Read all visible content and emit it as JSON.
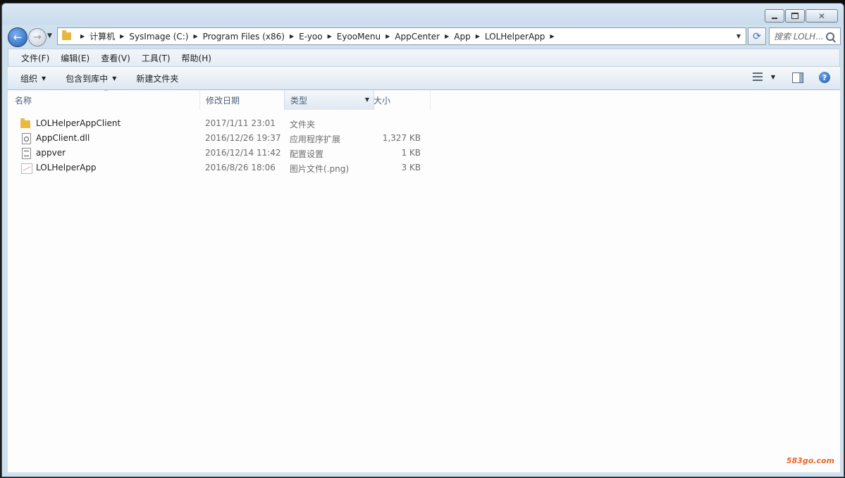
{
  "window": {
    "caption_buttons": {
      "minimize": "minimize-icon",
      "maximize": "maximize-icon",
      "close": "✕"
    }
  },
  "navbar": {
    "back_glyph": "←",
    "forward_glyph": "→",
    "recent_glyph": "▼",
    "breadcrumbs": [
      "计算机",
      "SysImage (C:)",
      "Program Files (x86)",
      "E-yoo",
      "EyooMenu",
      "AppCenter",
      "App",
      "LOLHelperApp"
    ],
    "address_dropdown": "▼",
    "refresh_glyph": "⟳",
    "search_placeholder": "搜索 LOLH..."
  },
  "menubar": {
    "items": [
      "文件(F)",
      "编辑(E)",
      "查看(V)",
      "工具(T)",
      "帮助(H)"
    ]
  },
  "commandbar": {
    "organize": "组织",
    "include_library": "包含到库中",
    "new_folder": "新建文件夹",
    "dropdown_glyph": "▼",
    "help": "?"
  },
  "columns": {
    "name": "名称",
    "date": "修改日期",
    "type": "类型",
    "size": "大小",
    "sort_glyph": "^"
  },
  "files": [
    {
      "name": "LOLHelperAppClient",
      "date": "2017/1/11 23:01",
      "type": "文件夹",
      "size": "",
      "icon": "folder-icon"
    },
    {
      "name": "AppClient.dll",
      "date": "2016/12/26 19:37",
      "type": "应用程序扩展",
      "size": "1,327 KB",
      "icon": "dll-file-icon"
    },
    {
      "name": "appver",
      "date": "2016/12/14 11:42",
      "type": "配置设置",
      "size": "1 KB",
      "icon": "config-file-icon"
    },
    {
      "name": "LOLHelperApp",
      "date": "2016/8/26 18:06",
      "type": "图片文件(.png)",
      "size": "3 KB",
      "icon": "image-file-icon"
    }
  ],
  "watermark": "583go.com"
}
